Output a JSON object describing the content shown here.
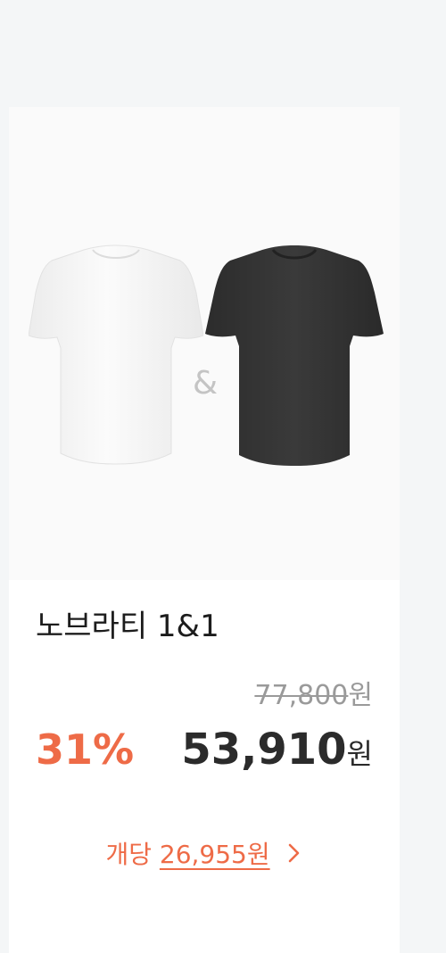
{
  "product": {
    "image_alt": "white and black t-shirt set",
    "connector": "&",
    "name": "노브라티 1&1",
    "original_price": "77,800",
    "original_price_unit": "원",
    "discount_rate": "31%",
    "sale_price": "53,910",
    "sale_price_unit": "원",
    "per_unit_label": "개당",
    "per_unit_price": "26,955원"
  },
  "icons": {
    "shirt_white": "white-tshirt",
    "shirt_black": "black-tshirt",
    "chevron": "chevron-right-icon"
  },
  "colors": {
    "accent": "#ee6b47",
    "price": "#2b2b2b",
    "strikethrough": "#9a9a9a",
    "shirt_white": "#f2f2f2",
    "shirt_black": "#333333"
  }
}
